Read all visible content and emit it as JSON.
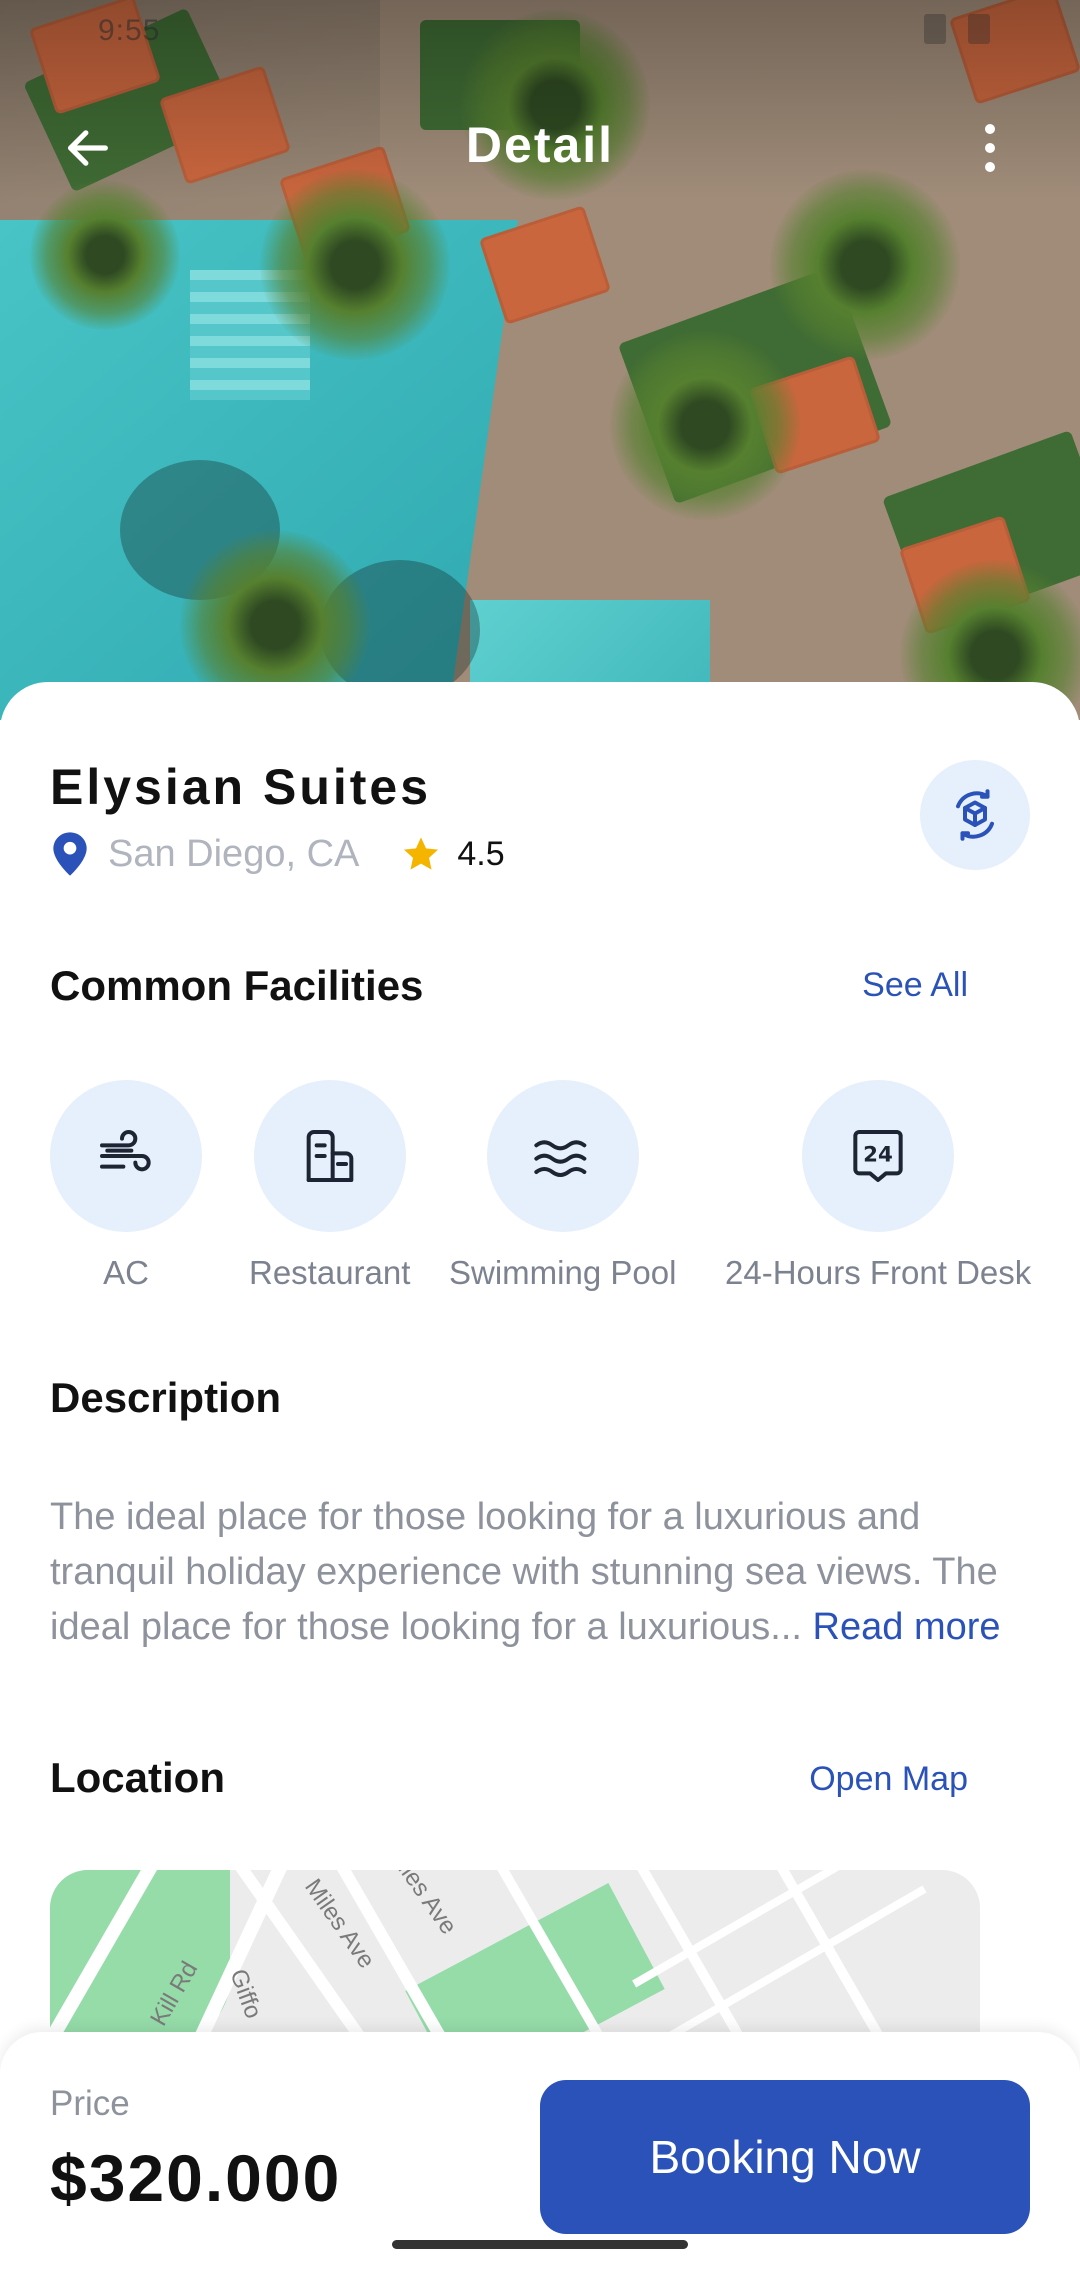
{
  "status_bar": {
    "time": "9:55"
  },
  "topbar": {
    "title": "Detail",
    "back_icon": "arrow-left-icon",
    "more_icon": "more-vertical-icon"
  },
  "hotel": {
    "name": "Elysian Suites",
    "location": "San Diego, CA",
    "rating": "4.5",
    "location_icon": "map-pin-icon",
    "rating_icon": "star-icon",
    "tour_icon": "360-view-icon"
  },
  "facilities": {
    "title": "Common Facilities",
    "see_all": "See All",
    "items": [
      {
        "label": "AC",
        "icon": "wind-icon"
      },
      {
        "label": "Restaurant",
        "icon": "restaurant-icon"
      },
      {
        "label": "Swimming Pool",
        "icon": "waves-icon"
      },
      {
        "label": "24-Hours Front Desk",
        "icon": "24-hours-icon"
      }
    ]
  },
  "description": {
    "title": "Description",
    "text": "The ideal place for those looking for a luxurious and tranquil holiday experience with stunning sea views. The ideal place for those looking for a luxurious...",
    "read_more": "Read more"
  },
  "location": {
    "title": "Location",
    "open_map": "Open Map",
    "map_labels": [
      "Miles Ave",
      "Miles Ave",
      "Giffo",
      "Kill Rd"
    ]
  },
  "booking": {
    "price_label": "Price",
    "price": "$320.000",
    "button": "Booking Now"
  },
  "colors": {
    "accent": "#2a52b8",
    "icon_bg": "#e6effc",
    "muted_text": "#8d929c",
    "star": "#f5b400"
  }
}
